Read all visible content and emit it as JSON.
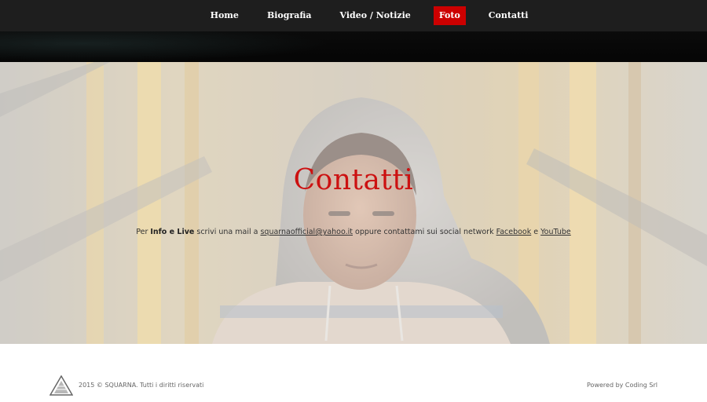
{
  "nav": {
    "items": [
      {
        "label": "Home",
        "active": false
      },
      {
        "label": "Biografia",
        "active": false
      },
      {
        "label": "Video / Notizie",
        "active": false
      },
      {
        "label": "Foto",
        "active": true
      },
      {
        "label": "Contatti",
        "active": false
      }
    ]
  },
  "hero": {
    "title": "Contatti",
    "text": {
      "prefix": "Per ",
      "bold": "Info e Live",
      "middle": " scrivi una mail a ",
      "email": "squarnaofficial@yahoo.it",
      "after_email": " oppure contattami sui social network ",
      "facebook": "Facebook",
      "conj": " e ",
      "youtube": "YouTube"
    }
  },
  "footer": {
    "copyright": "2015 © SQUARNA. Tutti i diritti riservati",
    "powered": "Powered by Coding Srl",
    "logo_icon": "squarna-logo-icon"
  },
  "colors": {
    "nav_bg": "#1e1e1e",
    "accent": "#cc0000",
    "title_red": "#cc1111"
  }
}
